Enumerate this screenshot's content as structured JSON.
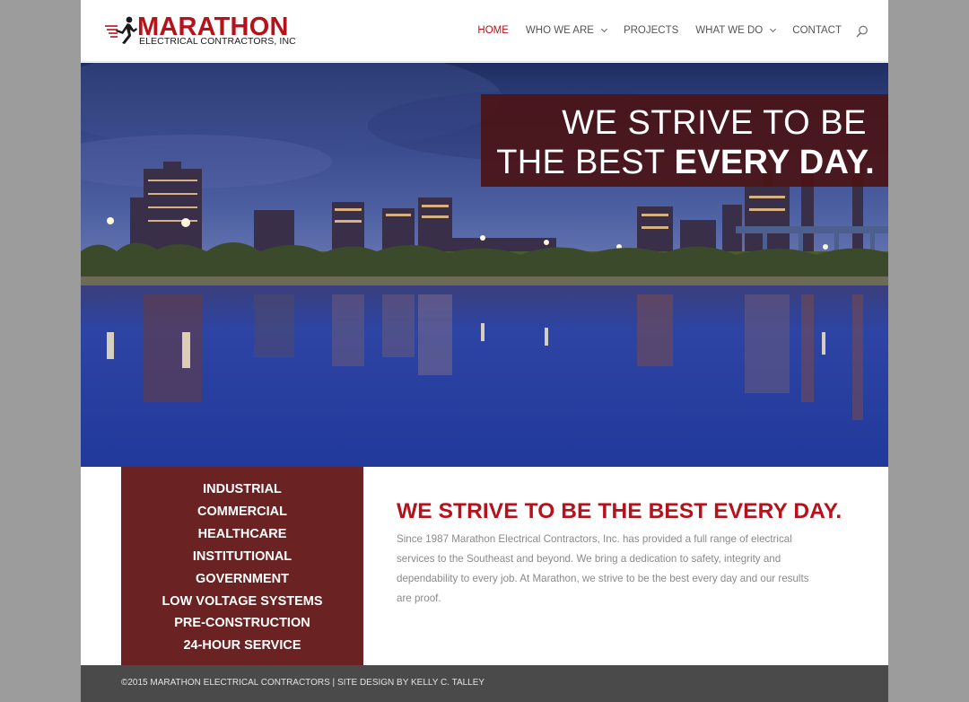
{
  "brand": {
    "name": "MARATHON",
    "subtitle": "ELECTRICAL CONTRACTORS, INC"
  },
  "nav": {
    "items": [
      {
        "label": "HOME",
        "active": true,
        "dropdown": false
      },
      {
        "label": "WHO WE ARE",
        "active": false,
        "dropdown": true
      },
      {
        "label": "PROJECTS",
        "active": false,
        "dropdown": false
      },
      {
        "label": "WHAT WE DO",
        "active": false,
        "dropdown": true
      },
      {
        "label": "CONTACT",
        "active": false,
        "dropdown": false
      }
    ],
    "search_icon": "search-icon"
  },
  "hero": {
    "tagline_line1": "WE STRIVE TO BE",
    "tagline_line2_light": "THE BEST ",
    "tagline_line2_bold": "EVERY DAY."
  },
  "services": [
    "INDUSTRIAL",
    "COMMERCIAL",
    "HEALTHCARE",
    "INSTITUTIONAL",
    "GOVERNMENT",
    "LOW VOLTAGE SYSTEMS",
    "PRE-CONSTRUCTION",
    "24-HOUR SERVICE"
  ],
  "intro": {
    "headline": "WE STRIVE TO BE THE BEST EVERY DAY.",
    "body": "Since 1987 Marathon Electrical Contractors, Inc. has provided a full range of electrical services to the Southeast and beyond. We bring a dedication to safety, integrity and dependability to every job. At Marathon, we strive to be the best every day and our results are proof."
  },
  "footer": {
    "text": "©2015 MARATHON ELECTRICAL CONTRACTORS | SITE DESIGN BY KELLY C. TALLEY"
  },
  "colors": {
    "brand_red": "#b5121b",
    "services_bg": "#6b2222",
    "tagline_bg": "#4b1416",
    "footer_bg": "#4a4a4a"
  }
}
